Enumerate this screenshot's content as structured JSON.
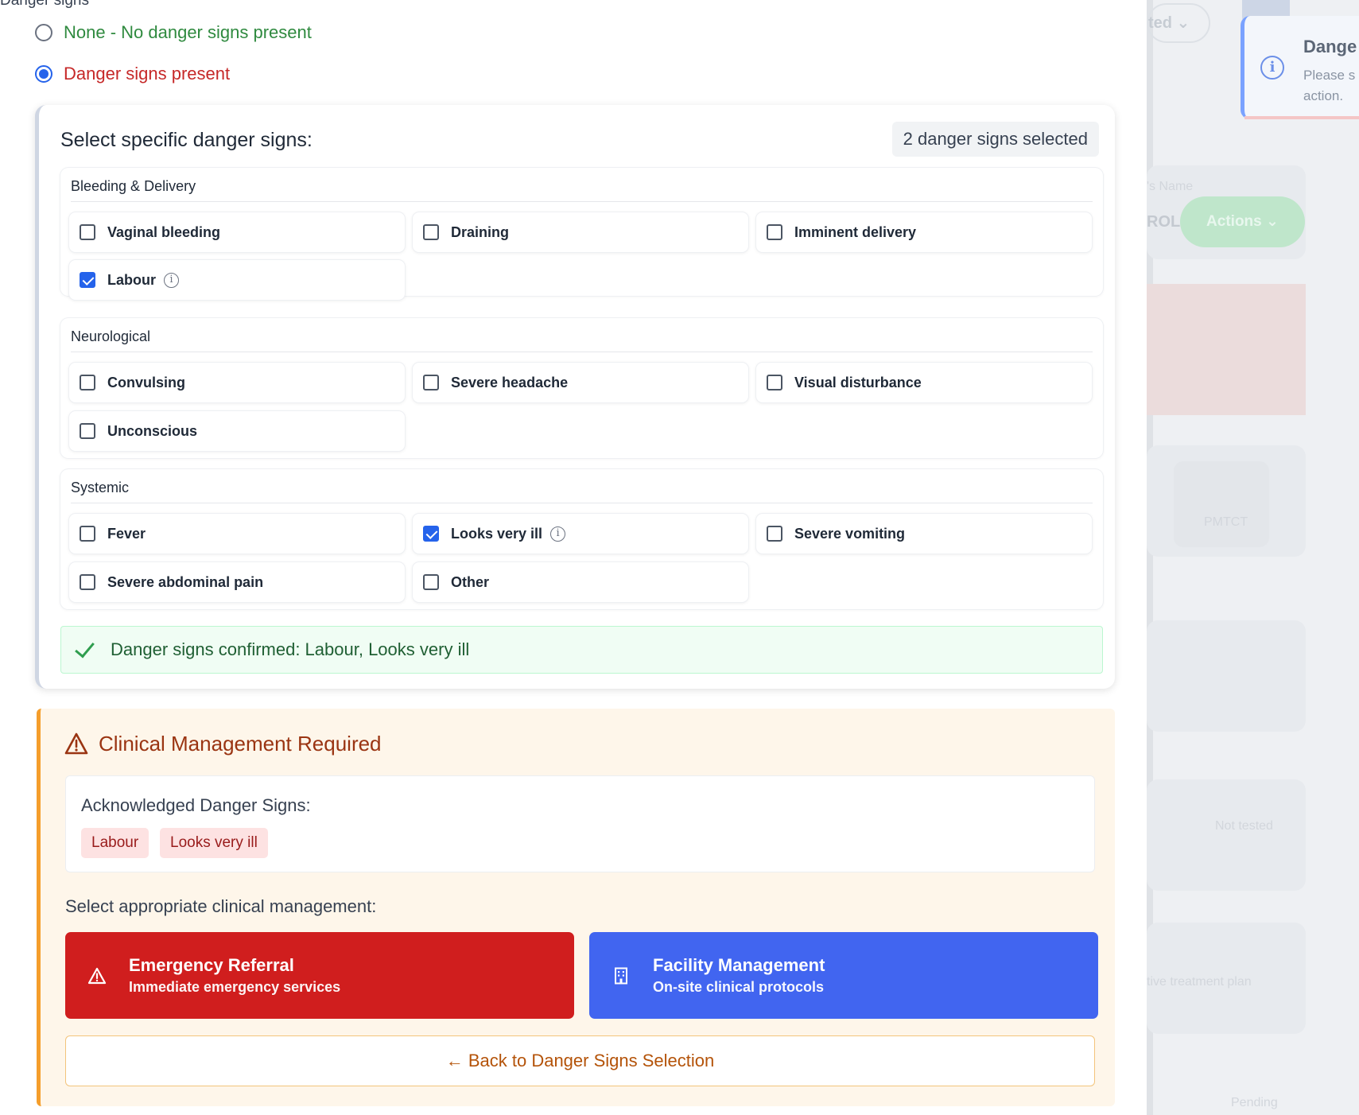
{
  "header_cutoff_text": "Danger signs",
  "radio_options": [
    {
      "label": "None - No danger signs present",
      "checked": false,
      "color": "#2f8a3f"
    },
    {
      "label": "Danger signs present",
      "checked": true,
      "color": "#c62828"
    }
  ],
  "selection": {
    "title": "Select specific danger signs:",
    "count_badge": "2 danger signs selected",
    "groups": [
      {
        "title": "Bleeding & Delivery",
        "items": [
          {
            "label": "Vaginal bleeding",
            "checked": false,
            "info": false
          },
          {
            "label": "Draining",
            "checked": false,
            "info": false
          },
          {
            "label": "Imminent delivery",
            "checked": false,
            "info": false
          },
          {
            "label": "Labour",
            "checked": true,
            "info": true
          }
        ]
      },
      {
        "title": "Neurological",
        "items": [
          {
            "label": "Convulsing",
            "checked": false,
            "info": false
          },
          {
            "label": "Severe headache",
            "checked": false,
            "info": false
          },
          {
            "label": "Visual disturbance",
            "checked": false,
            "info": false
          },
          {
            "label": "Unconscious",
            "checked": false,
            "info": false
          }
        ]
      },
      {
        "title": "Systemic",
        "items": [
          {
            "label": "Fever",
            "checked": false,
            "info": false
          },
          {
            "label": "Looks very ill",
            "checked": true,
            "info": true
          },
          {
            "label": "Severe vomiting",
            "checked": false,
            "info": false
          },
          {
            "label": "Severe abdominal pain",
            "checked": false,
            "info": false
          },
          {
            "label": "Other",
            "checked": false,
            "info": false
          }
        ]
      }
    ],
    "confirmation": "Danger signs confirmed: Labour, Looks very ill"
  },
  "clinical": {
    "title": "Clinical Management Required",
    "ack_title": "Acknowledged Danger Signs:",
    "ack_tags": [
      "Labour",
      "Looks very ill"
    ],
    "select_label": "Select appropriate clinical management:",
    "emergency": {
      "title": "Emergency Referral",
      "subtitle": "Immediate emergency services",
      "color": "#d01e1e"
    },
    "facility": {
      "title": "Facility Management",
      "subtitle": "On-site clinical protocols",
      "color": "#4165f0"
    },
    "back_label": "← Back to Danger Signs Selection"
  },
  "background": {
    "pill_text": "ted",
    "name_label": "'s Name",
    "rol_text": "ROL",
    "actions_label": "Actions",
    "pmtct_label": "PMTCT",
    "not_tested": "Not tested",
    "treatment_plan": "tive treatment plan",
    "pending": "Pending"
  },
  "toast": {
    "title": "Dange",
    "body_line1": "Please s",
    "body_line2": "action."
  }
}
